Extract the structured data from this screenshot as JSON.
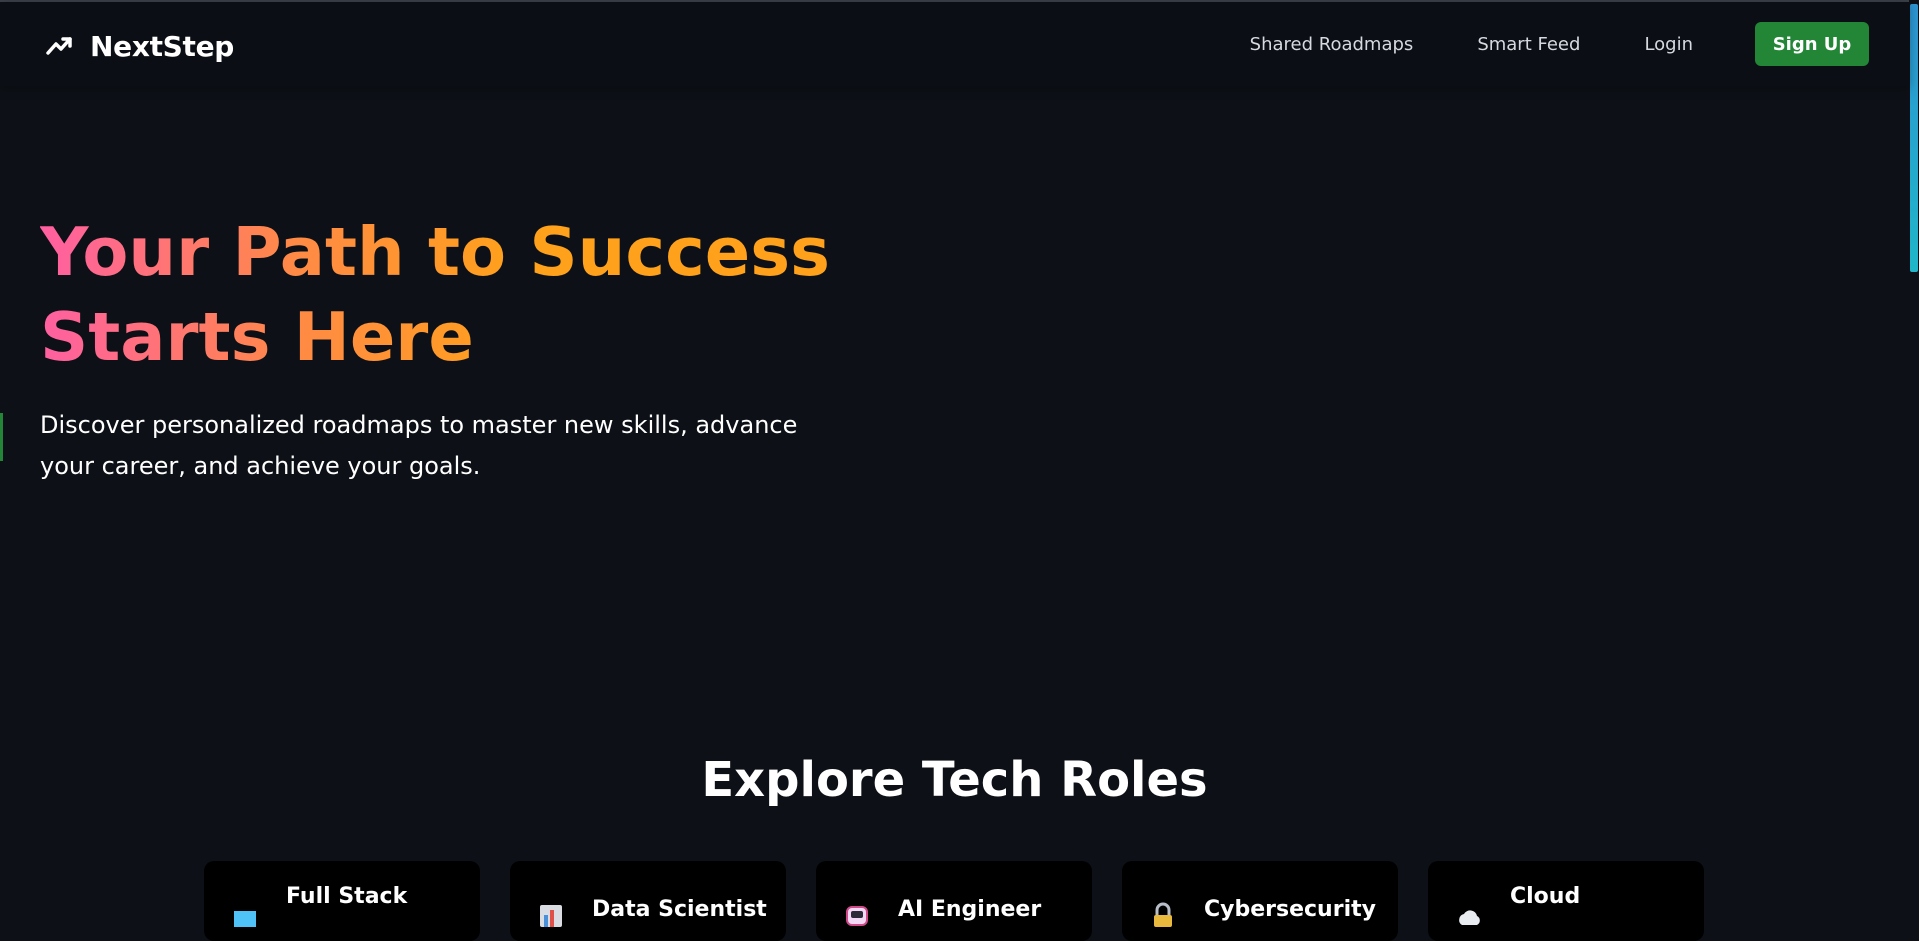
{
  "nav": {
    "brand": "NextStep",
    "links": [
      "Shared Roadmaps",
      "Smart Feed",
      "Login"
    ],
    "signup": "Sign Up"
  },
  "hero": {
    "title": "Your Path to Success Starts Here",
    "subtitle": "Discover personalized roadmaps to master new skills, advance your career, and achieve your goals."
  },
  "roles": {
    "heading": "Explore Tech Roles",
    "cards": [
      {
        "title": "Full Stack",
        "icon": "monitor-icon"
      },
      {
        "title": "Data Scientist",
        "icon": "chart-icon"
      },
      {
        "title": "AI Engineer",
        "icon": "robot-icon"
      },
      {
        "title": "Cybersecurity",
        "icon": "lock-icon"
      },
      {
        "title": "Cloud",
        "icon": "cloud-icon"
      }
    ]
  },
  "colors": {
    "accent": "#238636",
    "gradient_start": "#ff5fa2",
    "gradient_end": "#ffa11a",
    "background": "#0d1117"
  }
}
